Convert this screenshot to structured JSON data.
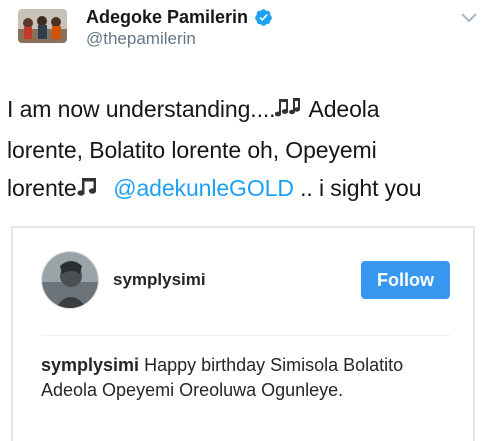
{
  "tweet": {
    "author": {
      "display_name": "Adegoke Pamilerin",
      "handle": "@thepamilerin",
      "verified": true
    },
    "text_parts": {
      "line1": "I am now understanding....",
      "line1_after_icon": " Adeola",
      "line2": "lorente, Bolatito lorente oh, Opeyemi",
      "line3": "lorente",
      "mention": "@adekunleGOLD",
      "line3_end": " .. i sight you"
    },
    "icons": {
      "music_notes": "multiple-musical-notes-icon",
      "music_note": "musical-note-icon",
      "menu": "chevron-down-icon",
      "verified": "verified-badge-icon"
    }
  },
  "embed": {
    "username": "symplysimi",
    "follow_label": "Follow",
    "caption_user": "symplysimi",
    "caption_text": " Happy birthday Simisola Bolatito Adeola Opeyemi Oreoluwa Ogunleye."
  },
  "colors": {
    "link": "#1da1f2",
    "follow_button": "#3897f0",
    "verified": "#1da1f2",
    "handle": "#657786"
  }
}
